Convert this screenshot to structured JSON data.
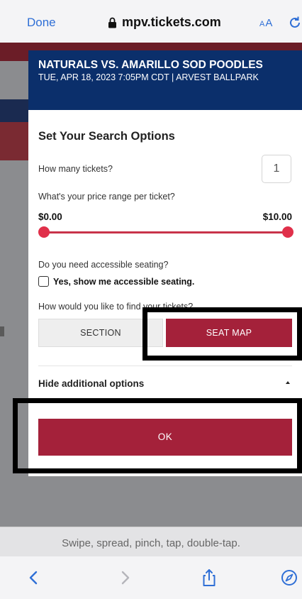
{
  "browser": {
    "done_label": "Done",
    "url": "mpv.tickets.com",
    "text_size_label_small": "A",
    "text_size_label_large": "A",
    "accent_color": "#2f6fd6"
  },
  "modal": {
    "event_title": "NATURALS VS. AMARILLO SOD POODLES",
    "event_subtitle": "TUE, APR 18, 2023 7:05PM CDT | ARVEST BALLPARK",
    "header_color": "#0b2f6b",
    "section_title": "Set Your Search Options",
    "tickets_question": "How many tickets?",
    "tickets_value": "1",
    "price_question": "What's your price range per ticket?",
    "price_min": "$0.00",
    "price_max": "$10.00",
    "accessible_question": "Do you need accessible seating?",
    "accessible_checkbox_label": "Yes, show me accessible seating.",
    "find_question": "How would you like to find your tickets?",
    "section_button": "SECTION",
    "seat_map_button": "SEAT MAP",
    "hide_options": "Hide additional options",
    "ok_button": "OK",
    "accent_color": "#a4213a"
  },
  "gesture_hint": "Swipe, spread, pinch, tap, double-tap.",
  "toolbar": {
    "icons": [
      "back-icon",
      "forward-icon",
      "share-icon",
      "compass-icon"
    ]
  }
}
